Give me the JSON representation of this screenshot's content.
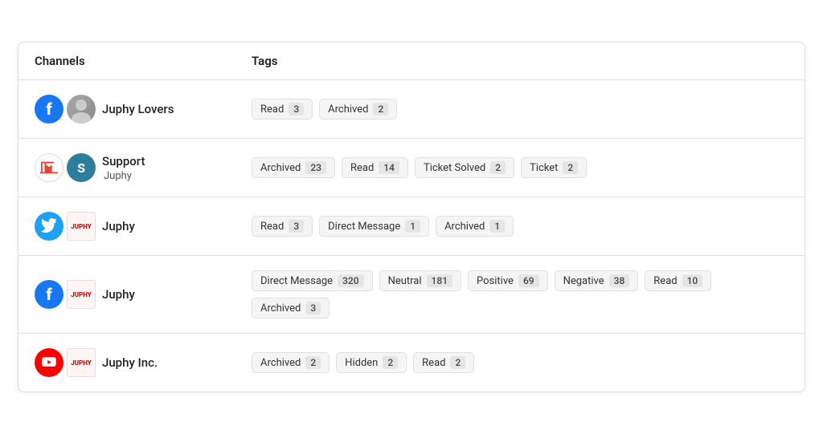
{
  "header": {
    "col_channels": "Channels",
    "col_tags": "Tags"
  },
  "rows": [
    {
      "id": "juphy-lovers",
      "channel_name": "Juphy Lovers",
      "sub_name": null,
      "platform": "facebook",
      "has_avatar": true,
      "tags": [
        {
          "label": "Read",
          "count": "3"
        },
        {
          "label": "Archived",
          "count": "2"
        }
      ]
    },
    {
      "id": "support-juphy",
      "channel_name": "Support",
      "sub_name": "Juphy",
      "platform": "gmail+support",
      "has_avatar": false,
      "tags": [
        {
          "label": "Archived",
          "count": "23"
        },
        {
          "label": "Read",
          "count": "14"
        },
        {
          "label": "Ticket Solved",
          "count": "2"
        },
        {
          "label": "Ticket",
          "count": "2"
        }
      ]
    },
    {
      "id": "juphy-twitter",
      "channel_name": "Juphy",
      "sub_name": null,
      "platform": "twitter",
      "has_avatar": false,
      "tags": [
        {
          "label": "Read",
          "count": "3"
        },
        {
          "label": "Direct Message",
          "count": "1"
        },
        {
          "label": "Archived",
          "count": "1"
        }
      ]
    },
    {
      "id": "juphy-facebook",
      "channel_name": "Juphy",
      "sub_name": null,
      "platform": "facebook2",
      "has_avatar": false,
      "tags": [
        {
          "label": "Direct Message",
          "count": "320"
        },
        {
          "label": "Neutral",
          "count": "181"
        },
        {
          "label": "Positive",
          "count": "69"
        },
        {
          "label": "Negative",
          "count": "38"
        },
        {
          "label": "Read",
          "count": "10"
        },
        {
          "label": "Archived",
          "count": "3"
        }
      ]
    },
    {
      "id": "juphy-inc",
      "channel_name": "Juphy Inc.",
      "sub_name": null,
      "platform": "youtube",
      "has_avatar": false,
      "tags": [
        {
          "label": "Archived",
          "count": "2"
        },
        {
          "label": "Hidden",
          "count": "2"
        },
        {
          "label": "Read",
          "count": "2"
        }
      ]
    }
  ]
}
